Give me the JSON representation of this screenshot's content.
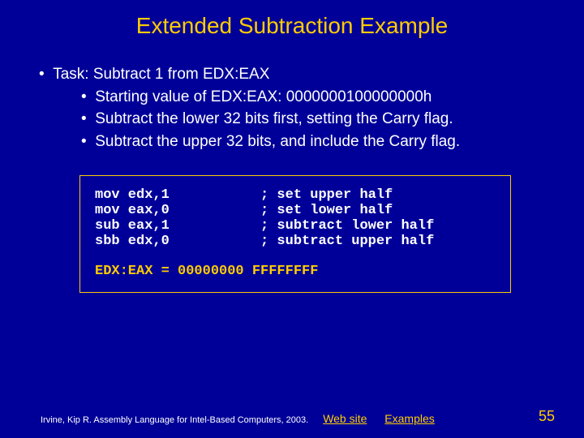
{
  "title": "Extended Subtraction Example",
  "bullets": {
    "task": "Task: Subtract 1 from EDX:EAX",
    "sub1": "Starting value of EDX:EAX: 0000000100000000h",
    "sub2": "Subtract the lower 32 bits first, setting the Carry flag.",
    "sub3": "Subtract the upper 32 bits, and include the Carry flag."
  },
  "code": {
    "l1": "mov edx,1           ; set upper half",
    "l2": "mov eax,0           ; set lower half",
    "l3": "sub eax,1           ; subtract lower half",
    "l4": "sbb edx,0           ; subtract upper half",
    "result": "EDX:EAX = 00000000 FFFFFFFF"
  },
  "footer": {
    "credit": "Irvine, Kip R. Assembly Language for Intel-Based Computers, 2003.",
    "link1": "Web site",
    "link2": "Examples",
    "page": "55"
  }
}
